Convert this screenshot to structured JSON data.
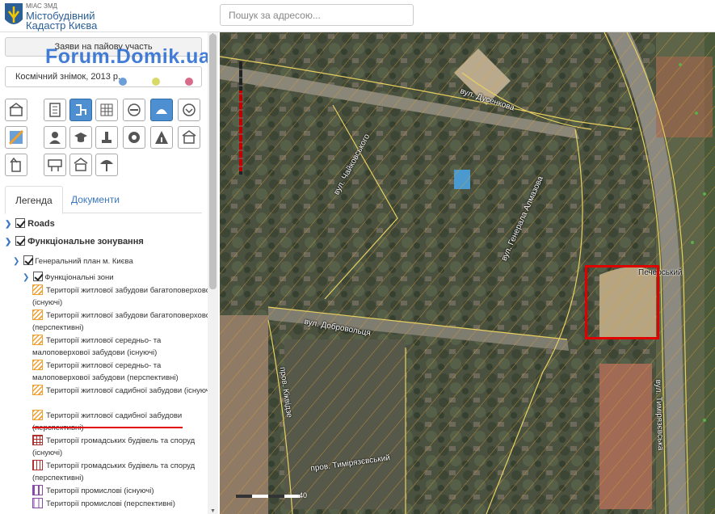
{
  "header": {
    "logo_line1": "МІАС ЗМД",
    "logo_line2": "Містобудівний",
    "logo_line3": "Кадастр Києва",
    "search_placeholder": "Пошук за адресою..."
  },
  "sidebar": {
    "apply_button": "Заяви на пайову участь",
    "basemap_select": "Космічний знімок, 2013 р.",
    "basemap_dot_colors": [
      "#6a9fd8",
      "#d9d96a",
      "#d86a8a"
    ],
    "watermark": "Forum.Domik.ua",
    "tools": [
      {
        "icon": "building-icon",
        "active": false
      },
      {
        "icon": "document-grid-icon",
        "active": false
      },
      {
        "icon": "network-icon",
        "active": true
      },
      {
        "icon": "grid-pattern-icon",
        "active": false
      },
      {
        "icon": "no-entry-icon",
        "active": false
      },
      {
        "icon": "layers-icon",
        "active": true
      },
      {
        "icon": "chevron-circle-icon",
        "active": false
      },
      {
        "icon": "map-pin-icon",
        "active": false
      },
      {
        "icon": "people-icon",
        "active": false
      },
      {
        "icon": "school-hat-icon",
        "active": false
      },
      {
        "icon": "monument-icon",
        "active": false
      },
      {
        "icon": "shield-badge-icon",
        "active": false
      },
      {
        "icon": "triangle-road-icon",
        "active": false
      },
      {
        "icon": "shop-icon",
        "active": false
      },
      {
        "icon": "building-arrow-icon",
        "active": false
      },
      {
        "icon": "billboard-icon",
        "active": false
      },
      {
        "icon": "market-icon",
        "active": false
      },
      {
        "icon": "kiosk-umbrella-icon",
        "active": false
      }
    ],
    "tabs": [
      {
        "label": "Легенда",
        "active": true
      },
      {
        "label": "Документи",
        "active": false
      }
    ],
    "tree": {
      "roads": "Roads",
      "zoning": "Функціональне зонування",
      "general_plan": "Генеральний план м. Києва",
      "functional_zones": "Функціональні зони"
    },
    "legend_items": [
      {
        "label": "Території житлової забудови багатоповерхової (існуючі)",
        "color": "#f0a030",
        "pattern": "hatch"
      },
      {
        "label": "Території житлової забудови багатоповерхової (перспективні)",
        "color": "#f0a030",
        "pattern": "hatch"
      },
      {
        "label": "Території житлової середньо- та малоповерхової забудови (існуючі)",
        "color": "#f0a030",
        "pattern": "hatch"
      },
      {
        "label": "Території житлової середньо- та малоповерхової забудови (перспективні)",
        "color": "#f0a030",
        "pattern": "hatch"
      },
      {
        "label": "Території житлової садибної забудови (існуючі)",
        "color": "#f0a030",
        "pattern": "hatch"
      },
      {
        "label": "Території житлової садибної забудови (перспективні)",
        "color": "#f0a030",
        "pattern": "hatch"
      },
      {
        "label": "Території громадських будівель та споруд (існуючі)",
        "color": "#b03030",
        "pattern": "grid"
      },
      {
        "label": "Території громадських будівель та споруд (перспективні)",
        "color": "#b03030",
        "pattern": "grid"
      },
      {
        "label": "Території промислові (існуючі)",
        "color": "#8a4aa8",
        "pattern": "bars"
      },
      {
        "label": "Території промислові (перспективні)",
        "color": "#8a4aa8",
        "pattern": "bars"
      }
    ]
  },
  "map": {
    "streets": [
      {
        "name": "вул. Дусенкова"
      },
      {
        "name": "вул. Чайковського"
      },
      {
        "name": "вул. Генерала Алмазова"
      },
      {
        "name": "вул. Добровольця"
      },
      {
        "name": "пров. Кіквідзе"
      },
      {
        "name": "пров. Тимірязєвський"
      },
      {
        "name": "вул. Тимірязєвська"
      }
    ],
    "district_label": "Печерський",
    "scale_label": "40"
  }
}
